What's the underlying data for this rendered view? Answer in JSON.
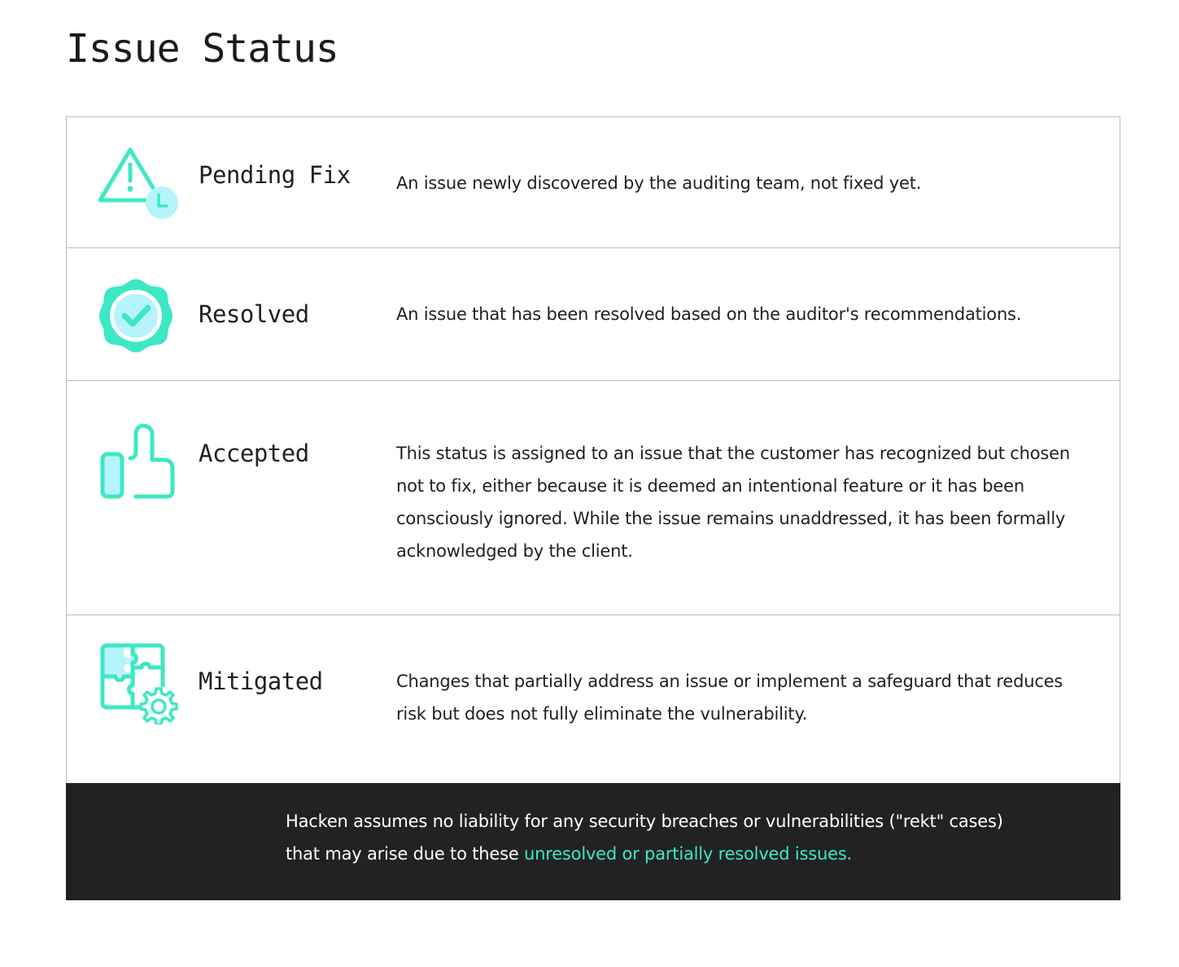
{
  "page": {
    "title": "Issue Status"
  },
  "colors": {
    "accent": "#3de8c4",
    "accent_light": "#b6f4fb",
    "banner_bg": "#222222",
    "border": "#bdbdbd"
  },
  "statuses": [
    {
      "name": "Pending Fix",
      "icon": "warning-clock-icon",
      "description": "An issue newly discovered by the auditing team, not fixed yet."
    },
    {
      "name": "Resolved",
      "icon": "check-badge-icon",
      "description": "An issue that has been resolved based on the auditor's recommendations."
    },
    {
      "name": "Accepted",
      "icon": "thumbs-up-icon",
      "description": "This status is assigned to an issue that the customer has recognized but chosen not to fix, either because it is deemed an intentional feature or it has been consciously ignored. While the issue remains unaddressed, it has been formally acknowledged by the client."
    },
    {
      "name": "Mitigated",
      "icon": "puzzle-gear-icon",
      "description": "Changes that partially address an issue or implement a safeguard that reduces risk but does not fully eliminate the vulnerability."
    }
  ],
  "footer": {
    "text": "Hacken assumes no liability for any security breaches or vulnerabilities (\"rekt\" cases) that may arise due to these ",
    "highlight": "unresolved or partially resolved issues."
  }
}
